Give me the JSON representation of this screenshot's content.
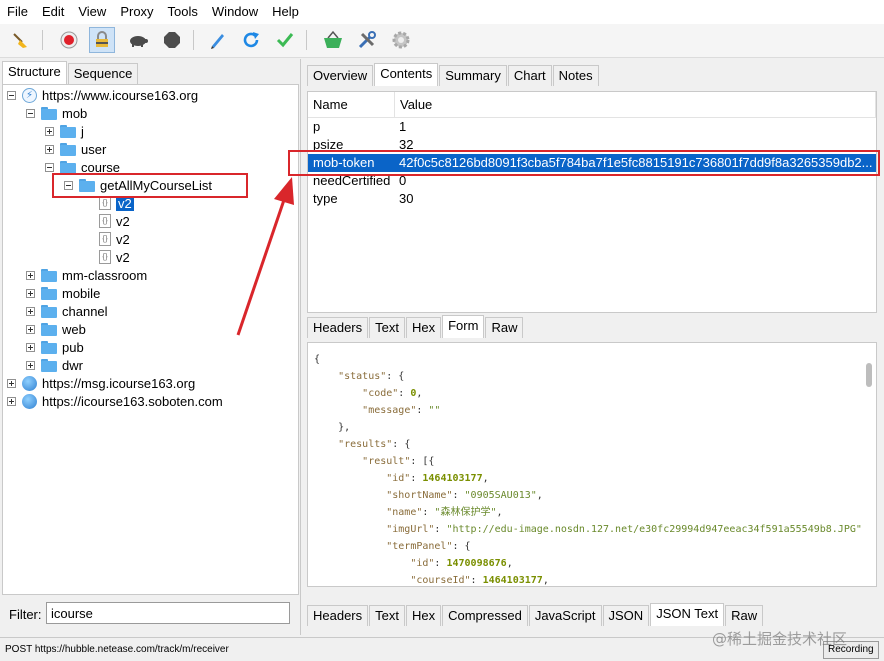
{
  "menu": [
    "File",
    "Edit",
    "View",
    "Proxy",
    "Tools",
    "Window",
    "Help"
  ],
  "left": {
    "tabs": [
      "Structure",
      "Sequence"
    ],
    "tree": [
      {
        "label": "https://www.icourse163.org",
        "type": "host-active",
        "expander": "minus"
      },
      {
        "label": "mob",
        "type": "folder",
        "expander": "minus"
      },
      {
        "label": "j",
        "type": "folder",
        "expander": "plus"
      },
      {
        "label": "user",
        "type": "folder",
        "expander": "plus"
      },
      {
        "label": "course",
        "type": "folder",
        "expander": "minus"
      },
      {
        "label": "getAllMyCourseList",
        "type": "folder",
        "expander": "minus"
      },
      {
        "label": "v2",
        "type": "file",
        "selected": true
      },
      {
        "label": "v2",
        "type": "file"
      },
      {
        "label": "v2",
        "type": "file"
      },
      {
        "label": "v2",
        "type": "file"
      },
      {
        "label": "mm-classroom",
        "type": "folder",
        "expander": "plus"
      },
      {
        "label": "mobile",
        "type": "folder",
        "expander": "plus"
      },
      {
        "label": "channel",
        "type": "folder",
        "expander": "plus"
      },
      {
        "label": "web",
        "type": "folder",
        "expander": "plus"
      },
      {
        "label": "pub",
        "type": "folder",
        "expander": "plus"
      },
      {
        "label": "dwr",
        "type": "folder",
        "expander": "plus"
      },
      {
        "label": "https://msg.icourse163.org",
        "type": "host",
        "expander": "plus"
      },
      {
        "label": "https://icourse163.soboten.com",
        "type": "host",
        "expander": "plus"
      }
    ],
    "filter_label": "Filter:",
    "filter_value": "icourse"
  },
  "right": {
    "top_tabs": [
      "Overview",
      "Contents",
      "Summary",
      "Chart",
      "Notes"
    ],
    "active_top_tab": "Contents",
    "table_headers": {
      "name": "Name",
      "value": "Value"
    },
    "rows": [
      {
        "name": "p",
        "value": "1"
      },
      {
        "name": "psize",
        "value": "32"
      },
      {
        "name": "mob-token",
        "value": "42f0c5c8126bd8091f3cba5f784ba7f1e5fc8815191c736801f7dd9f8a3265359db2...",
        "selected": true
      },
      {
        "name": "needCertified",
        "value": "0"
      },
      {
        "name": "type",
        "value": "30"
      }
    ],
    "request_tabs": [
      "Headers",
      "Text",
      "Hex",
      "Form",
      "Raw"
    ],
    "active_request_tab": "Form",
    "json_lines": [
      "{",
      "    \"status\": {",
      "        \"code\": 0,",
      "        \"message\": \"\"",
      "    },",
      "    \"results\": {",
      "        \"result\": [{",
      "            \"id\": 1464103177,",
      "            \"shortName\": \"0905SAU013\",",
      "            \"name\": \"森林保护学\",",
      "            \"imgUrl\": \"http://edu-image.nosdn.127.net/e30fc29994d947eeac34f591a55549b8.JPG\"",
      "            \"termPanel\": {",
      "                \"id\": 1470098676,",
      "                \"courseId\": 1464103177,"
    ],
    "response_tabs": [
      "Headers",
      "Text",
      "Hex",
      "Compressed",
      "JavaScript",
      "JSON",
      "JSON Text",
      "Raw"
    ],
    "active_response_tab": "JSON Text"
  },
  "status": {
    "text": "POST https://hubble.netease.com/track/m/receiver",
    "recording": "Recording"
  },
  "watermark": "@稀土掘金技术社区",
  "colors": {
    "selection": "#0a64c8",
    "annotation_red": "#d9262b"
  }
}
